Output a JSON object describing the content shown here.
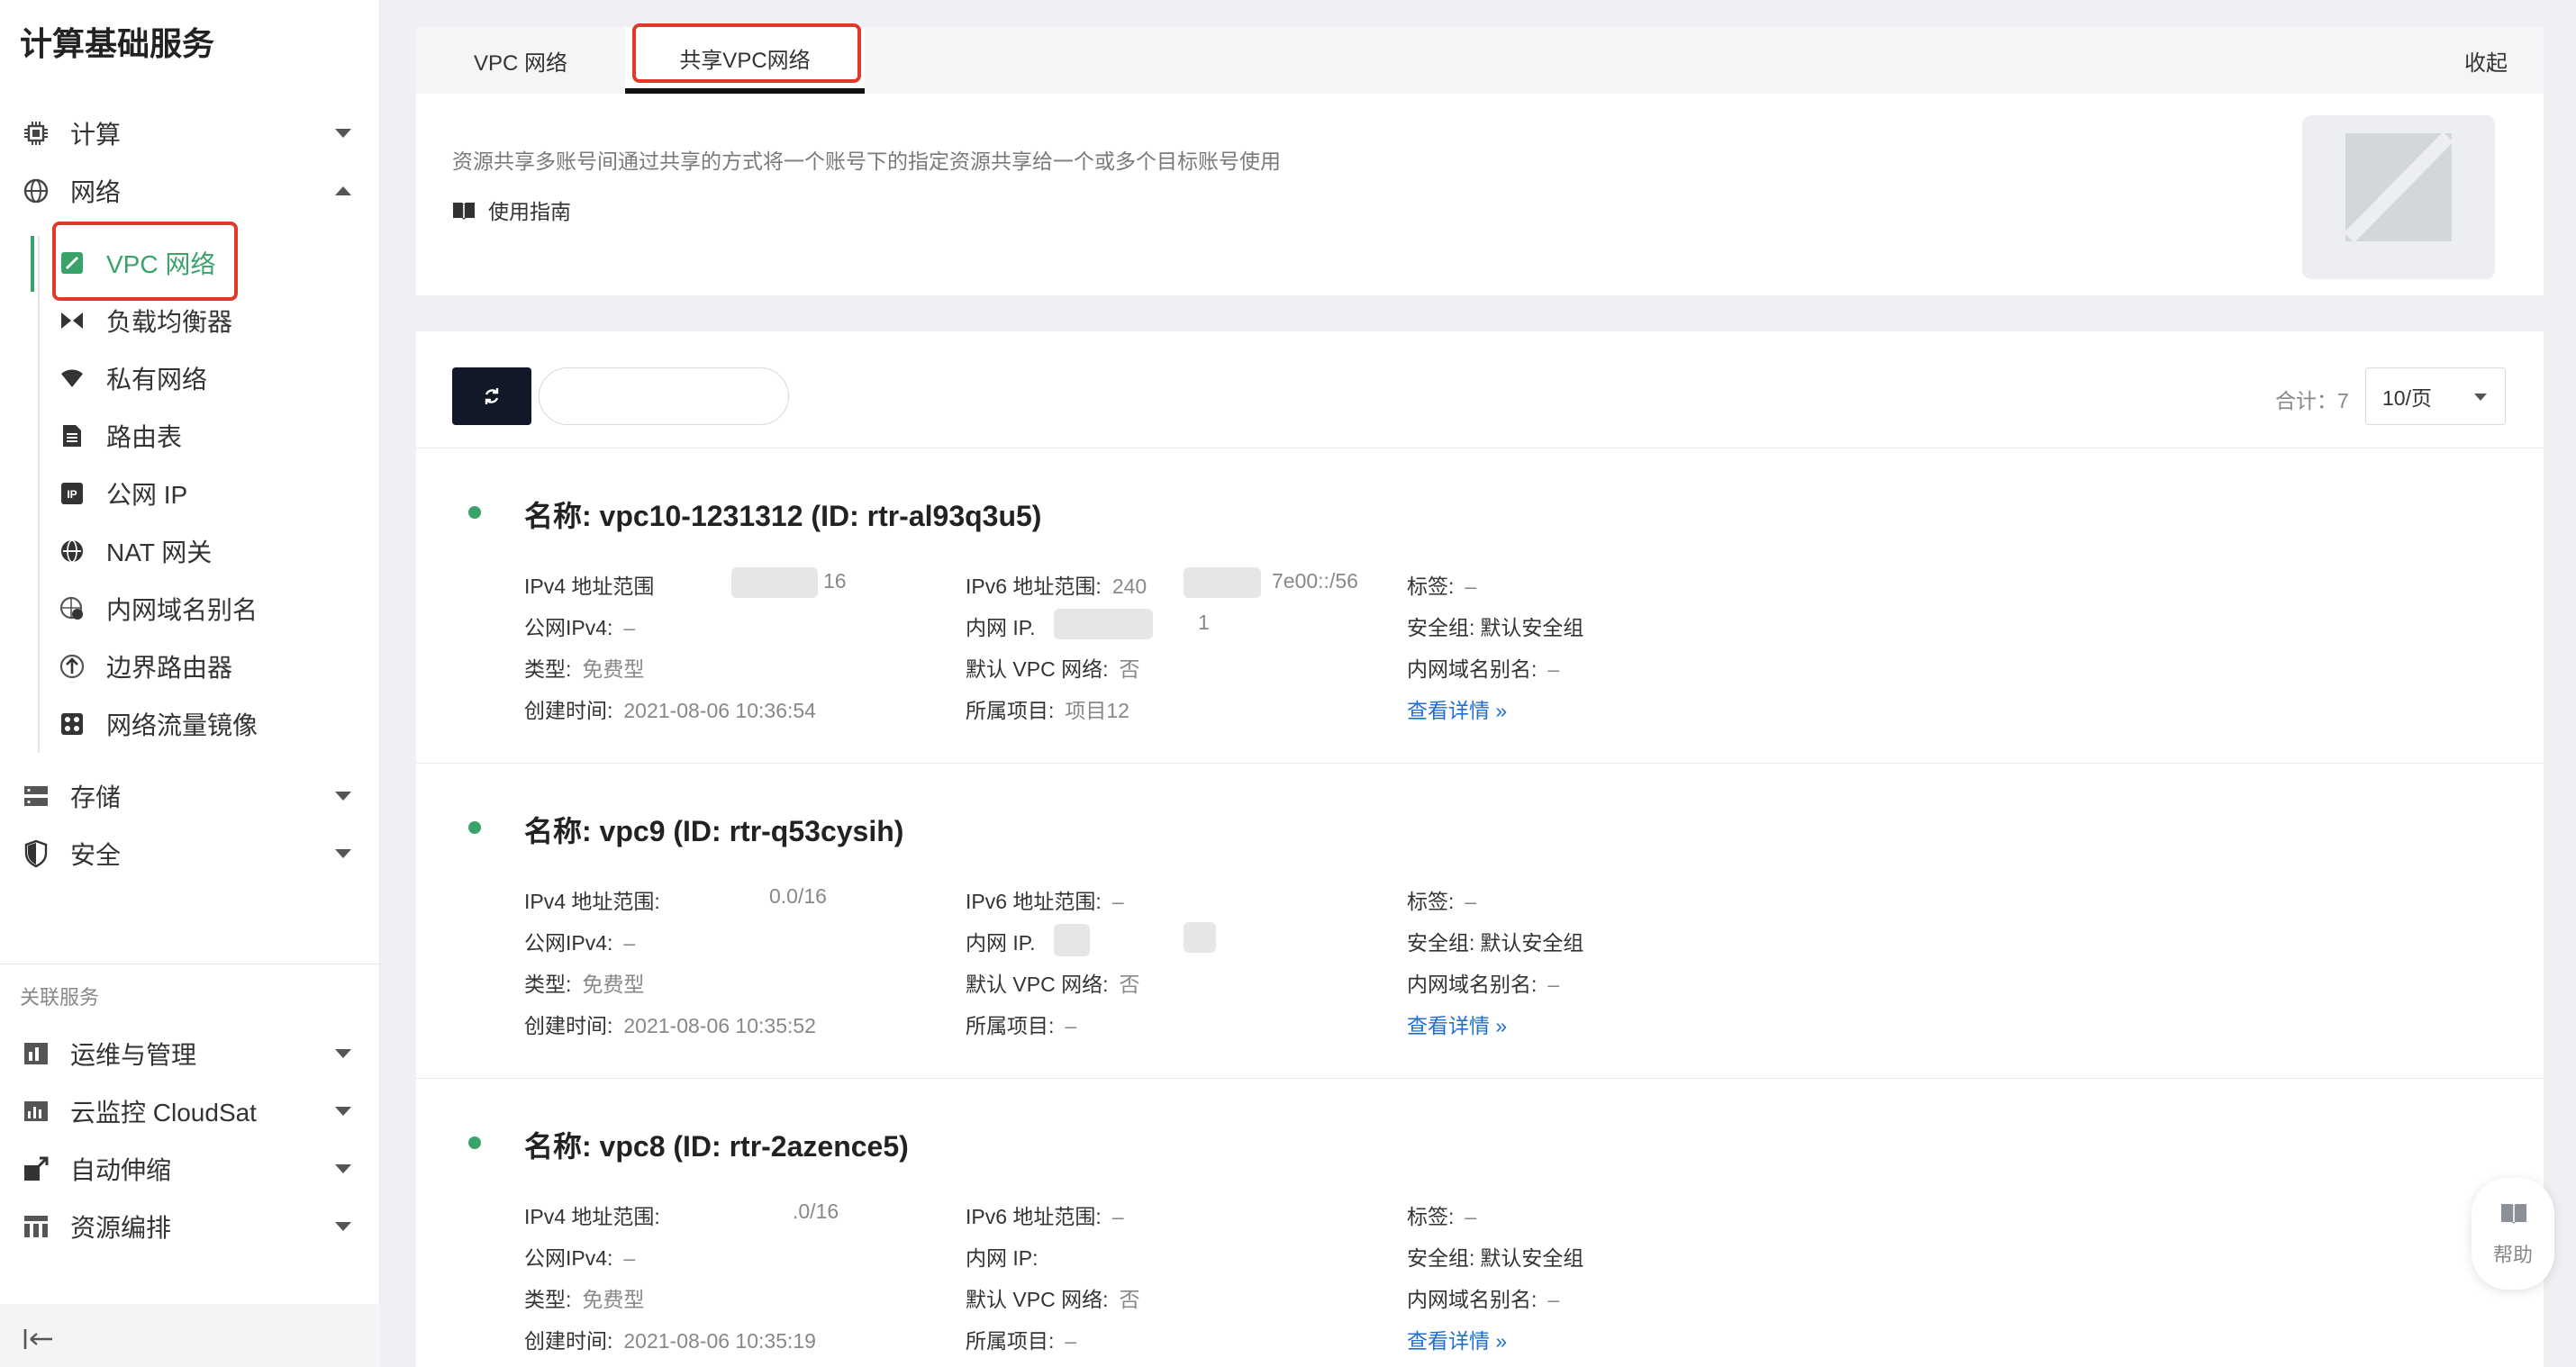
{
  "sidebar": {
    "title": "计算基础服务",
    "groups": {
      "compute": {
        "label": "计算",
        "icon": "chip-icon"
      },
      "network": {
        "label": "网络",
        "icon": "network-globe-icon"
      },
      "storage": {
        "label": "存储",
        "icon": "storage-icon"
      },
      "security": {
        "label": "安全",
        "icon": "shield-icon"
      }
    },
    "network_items": [
      {
        "label": "VPC 网络",
        "icon": "vpc-icon",
        "active": true
      },
      {
        "label": "负载均衡器",
        "icon": "load-balancer-icon"
      },
      {
        "label": "私有网络",
        "icon": "wifi-icon"
      },
      {
        "label": "路由表",
        "icon": "route-table-icon"
      },
      {
        "label": "公网 IP",
        "icon": "ip-icon"
      },
      {
        "label": "NAT 网关",
        "icon": "nat-icon"
      },
      {
        "label": "内网域名别名",
        "icon": "dns-icon"
      },
      {
        "label": "边界路由器",
        "icon": "border-router-icon"
      },
      {
        "label": "网络流量镜像",
        "icon": "traffic-mirror-icon"
      }
    ],
    "related_title": "关联服务",
    "related": [
      {
        "label": "运维与管理",
        "icon": "ops-icon"
      },
      {
        "label": "云监控 CloudSat",
        "icon": "monitor-icon"
      },
      {
        "label": "自动伸缩",
        "icon": "autoscale-icon"
      },
      {
        "label": "资源编排",
        "icon": "orchestration-icon"
      }
    ]
  },
  "tabs": {
    "vpc": "VPC 网络",
    "shared_vpc": "共享VPC网络",
    "collapse": "收起"
  },
  "intro": {
    "description": "资源共享多账号间通过共享的方式将一个账号下的指定资源共享给一个或多个目标账号使用",
    "guide": "使用指南"
  },
  "toolbar": {
    "search_placeholder": "",
    "total": "合计：7",
    "page_size": "10/页"
  },
  "vpcs": [
    {
      "name": "名称: vpc10-1231312 (ID: rtr-al93q3u5)",
      "ipv4_label": "IPv4 地址范围",
      "ipv4": "16",
      "ipv6_label": "IPv6 地址范围:",
      "ipv6_a": "240",
      "ipv6_b": "7e00::/56",
      "tag_label": "标签:",
      "tag": "–",
      "public_ipv4_label": "公网IPv4:",
      "public_ipv4": "–",
      "private_ip_label": "内网 IP.",
      "private_ip": "1",
      "secgroup_label": "安全组:",
      "secgroup": "默认安全组",
      "type_label": "类型:",
      "type": "免费型",
      "default_vpc_label": "默认 VPC 网络:",
      "default_vpc": "否",
      "dns_alias_label": "内网域名别名:",
      "dns_alias": "–",
      "created_label": "创建时间:",
      "created": "2021-08-06 10:36:54",
      "project_label": "所属项目:",
      "project": "项目12",
      "detail": "查看详情 »"
    },
    {
      "name": "名称: vpc9 (ID: rtr-q53cysih)",
      "ipv4_label": "IPv4 地址范围:",
      "ipv4": "0.0/16",
      "ipv6_label": "IPv6 地址范围:",
      "ipv6_a": "–",
      "ipv6_b": "",
      "tag_label": "标签:",
      "tag": "–",
      "public_ipv4_label": "公网IPv4:",
      "public_ipv4": "–",
      "private_ip_label": "内网 IP.",
      "private_ip": "",
      "secgroup_label": "安全组:",
      "secgroup": "默认安全组",
      "type_label": "类型:",
      "type": "免费型",
      "default_vpc_label": "默认 VPC 网络:",
      "default_vpc": "否",
      "dns_alias_label": "内网域名别名:",
      "dns_alias": "–",
      "created_label": "创建时间:",
      "created": "2021-08-06 10:35:52",
      "project_label": "所属项目:",
      "project": "–",
      "detail": "查看详情 »"
    },
    {
      "name": "名称: vpc8 (ID: rtr-2azence5)",
      "ipv4_label": "IPv4 地址范围:",
      "ipv4": ".0/16",
      "ipv6_label": "IPv6 地址范围:",
      "ipv6_a": "–",
      "ipv6_b": "",
      "tag_label": "标签:",
      "tag": "–",
      "public_ipv4_label": "公网IPv4:",
      "public_ipv4": "–",
      "private_ip_label": "内网 IP:",
      "private_ip": "",
      "secgroup_label": "安全组:",
      "secgroup": "默认安全组",
      "type_label": "类型:",
      "type": "免费型",
      "default_vpc_label": "默认 VPC 网络:",
      "default_vpc": "否",
      "dns_alias_label": "内网域名别名:",
      "dns_alias": "–",
      "created_label": "创建时间:",
      "created": "2021-08-06 10:35:19",
      "project_label": "所属项目:",
      "project": "–",
      "detail": "查看详情 »"
    }
  ],
  "help": {
    "label": "帮助"
  },
  "colors": {
    "accent_green": "#3aa36a",
    "link_blue": "#1f6fd1",
    "highlight_red": "#e0392b",
    "dark_button": "#111827"
  }
}
